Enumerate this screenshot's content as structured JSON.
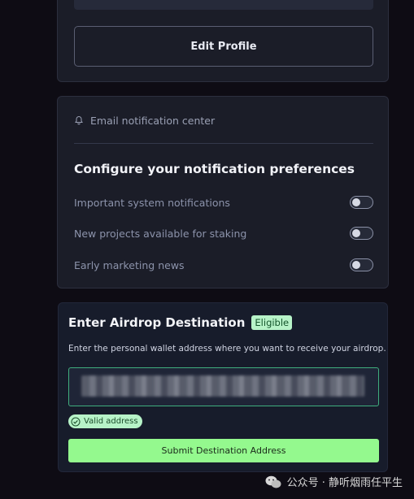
{
  "profile": {
    "edit_button_label": "Edit Profile"
  },
  "notifications": {
    "header_label": "Email notification center",
    "title": "Configure your notification preferences",
    "preferences": [
      {
        "label": "Important system notifications",
        "enabled": false
      },
      {
        "label": "New projects available for staking",
        "enabled": false
      },
      {
        "label": "Early marketing news",
        "enabled": false
      }
    ]
  },
  "airdrop": {
    "title": "Enter Airdrop Destination",
    "badge": "Eligible",
    "description": "Enter the personal wallet address where you want to receive your airdrop.",
    "valid_label": "Valid address",
    "submit_label": "Submit Destination Address"
  },
  "watermark": {
    "text": "公众号 · 静听烟雨任平生"
  },
  "colors": {
    "accent_green": "#94f98e",
    "badge_green": "#b7f3c8",
    "input_border": "#3fae7e"
  }
}
